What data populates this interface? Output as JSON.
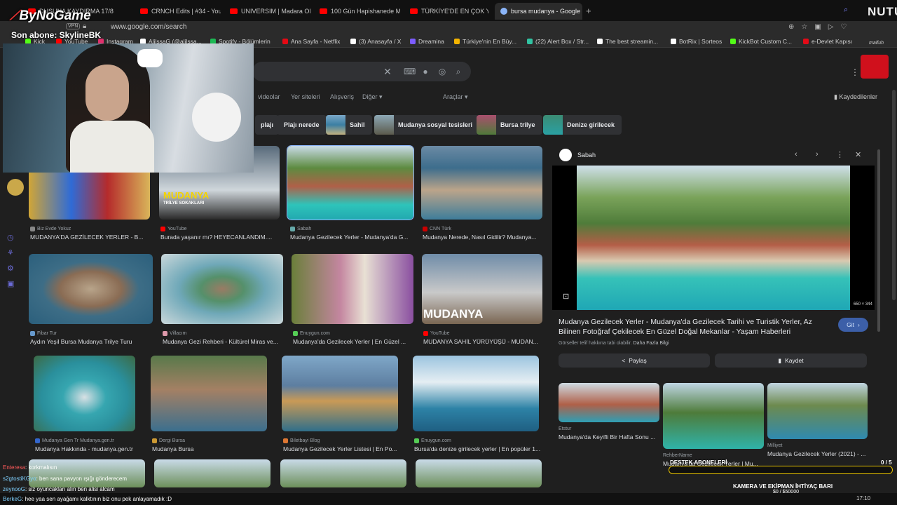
{
  "overlay": {
    "logo": "ByNoGame",
    "vpn": "VPN",
    "last_sub_label": "Son abone: SkylineBK",
    "corner_logo": "NUTU",
    "corner_logo_sub": "maifuh"
  },
  "browser": {
    "tabs": [
      {
        "label": "DUSUNA KAYDIRMA 17/8",
        "active": false
      },
      {
        "label": "CRNCH Edits | #34 - You",
        "active": false
      },
      {
        "label": "UNIVERSIM | Madara Old",
        "active": false
      },
      {
        "label": "100 Gün Hapishanede Ma",
        "active": false
      },
      {
        "label": "TÜRKİYE'DE EN ÇOK YE",
        "active": false
      },
      {
        "label": "bursa mudanya - Google",
        "active": true
      }
    ],
    "new_tab_icon": "plus-icon",
    "url": "www.google.com/search",
    "bookmarks": [
      {
        "label": "Kick",
        "color": "#53fc18"
      },
      {
        "label": "YouTube",
        "color": "#ff0000"
      },
      {
        "label": "Instagram",
        "color": "#e1306c"
      },
      {
        "label": "AlilssaG (@alilssa...",
        "color": "#ffffff"
      },
      {
        "label": "Spotify - Bölümlerin",
        "color": "#1db954"
      },
      {
        "label": "Ana Sayfa - Netflix",
        "color": "#e50914"
      },
      {
        "label": "(3) Anasayfa / X",
        "color": "#ffffff"
      },
      {
        "label": "Dreamina",
        "color": "#7c5cff"
      },
      {
        "label": "Türkiye'nin En Büy...",
        "color": "#f4b400"
      },
      {
        "label": "(22) Alert Box / Str...",
        "color": "#31c3a2"
      },
      {
        "label": "The best streamin...",
        "color": "#ffffff"
      },
      {
        "label": "BotRix | Sorteos",
        "color": "#ffffff"
      },
      {
        "label": "KickBot Custom C...",
        "color": "#53fc18"
      },
      {
        "label": "e-Devlet Kapısı",
        "color": "#e30a17"
      }
    ]
  },
  "search": {
    "nav_tabs": [
      "videolar",
      "Yer siteleri",
      "Alışveriş",
      "Diğer ▾"
    ],
    "tools": "Araçlar ▾",
    "saved": "Kaydedilenler",
    "chips": [
      {
        "label": "plajı",
        "thumb": false
      },
      {
        "label": "Plajı nerede",
        "thumb": false
      },
      {
        "label": "Sahil",
        "thumb": true
      },
      {
        "label": "Mudanya sosyal tesisleri",
        "thumb": true
      },
      {
        "label": "Bursa trilye",
        "thumb": true
      },
      {
        "label": "Denize girilecek",
        "thumb": true
      }
    ],
    "results": [
      {
        "source": "Biz Evde Yokuz",
        "title": "MUDANYA'DA GEZİLECEK YERLER - B..."
      },
      {
        "source": "YouTube",
        "title": "Burada yaşanır mı? HEYECANLANDIM....",
        "overlay_text": "MUDANYA",
        "overlay_sub": "TRİLYE SOKAKLARI"
      },
      {
        "source": "Sabah",
        "title": "Mudanya Gezilecek Yerler - Mudanya'da G..."
      },
      {
        "source": "CNN Türk",
        "title": "Mudanya Nerede, Nasıl Gidilir? Mudanya..."
      },
      {
        "source": "Fibar Tur",
        "title": "Aydın Yeşil Bursa Mudanya Trilye Turu"
      },
      {
        "source": "Villacım",
        "title": "Mudanya Gezi Rehberi - Kültürel Miras ve..."
      },
      {
        "source": "Enuygun.com",
        "title": "Mudanya'da Gezilecek Yerler | En Güzel ..."
      },
      {
        "source": "YouTube",
        "title": "MUDANYA SAHİL YÜRÜYÜŞÜ - MUDAN...",
        "overlay_text": "MUDANYA"
      },
      {
        "source": "Mudanya Gen Tr Mudanya.gen.tr",
        "title": "Mudanya Hakkında - mudanya.gen.tr"
      },
      {
        "source": "Dergi Bursa",
        "title": "Mudanya Bursa"
      },
      {
        "source": "Biletbayi Blog",
        "title": "Mudanya Gezilecek Yerler Listesi | En Po..."
      },
      {
        "source": "Enuygun.com",
        "title": "Bursa'da denize girilecek yerler | En popüler 1..."
      }
    ]
  },
  "panel": {
    "source": "Sabah",
    "image_size": "650 × 344",
    "title": "Mudanya Gezilecek Yerler - Mudanya'da Gezilecek Tarihi ve Turistik Yerler, Az Bilinen Fotoğraf Çekilecek En Güzel Doğal Mekanlar - Yaşam Haberleri",
    "visit_label": "Git",
    "copyright": "Görseller telif hakkına tabi olabilir.",
    "more_info": "Daha Fazla Bilgi",
    "share_label": "Paylaş",
    "save_label": "Kaydet",
    "related": [
      {
        "source": "Etstur",
        "title": "Mudanya'da Keyifli Bir Hafta Sonu ..."
      },
      {
        "source": "RehberName",
        "title": "Mudanya'da Gezilecek Yerler | Mu..."
      },
      {
        "source": "Milliyet",
        "title": "Mudanya Gezilecek Yerler (2021) - ..."
      }
    ]
  },
  "stream": {
    "support_label": "DESTEK ABONELERİ",
    "support_count": "0 / 5",
    "goal_title": "KAMERA VE EKİPMAN İHTİYAÇ BARI",
    "goal_value": "$0 / $50000",
    "goal_progress": 0,
    "chat": [
      {
        "user": "Enteresa",
        "msg": ": korkmalısın",
        "red": true
      },
      {
        "user": "s2gtostiKGyo",
        "msg": ": ben sana pavyon ışığı gönderecem",
        "red": false
      },
      {
        "user": "zeynooG",
        "msg": ": siz oyuncakları alın ben alisi alcam",
        "red": false
      },
      {
        "user": "BerkeG",
        "msg": ": hee yaa sen ayağamı kalktının biz onu pek anlayamadık :D",
        "red": false
      }
    ],
    "clock": "17:10"
  }
}
